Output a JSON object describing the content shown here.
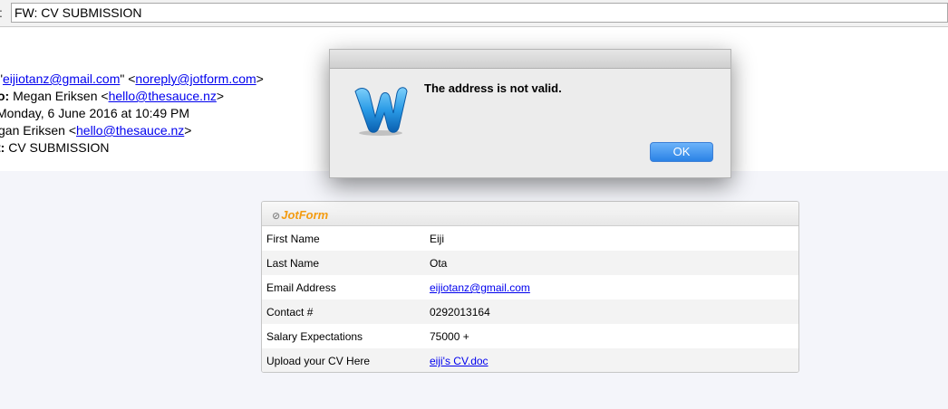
{
  "subject": {
    "prefix": ":",
    "value": "FW: CV SUBMISSION"
  },
  "headers": {
    "from_prefix": "\"",
    "from_link": "eijiotanz@gmail.com",
    "from_mid": "\" <",
    "from_link2": "noreply@jotform.com",
    "from_end": ">",
    "reply_label": "o:",
    "reply_name": " Megan Eriksen <",
    "reply_link": "hello@thesauce.nz",
    "reply_end": ">",
    "date_text": "Monday, 6 June 2016 at 10:49 PM",
    "to_name": "gan Eriksen <",
    "to_link": "hello@thesauce.nz",
    "to_end": ">",
    "subj_label": "t:",
    "subj_text": " CV SUBMISSION"
  },
  "jotform": {
    "logo_mark": "⊘",
    "logo_text": "JotForm",
    "rows": [
      {
        "label": "First Name",
        "value": "Eiji"
      },
      {
        "label": "Last Name",
        "value": "Ota"
      },
      {
        "label": "Email Address",
        "value": "eijiotanz@gmail.com"
      },
      {
        "label": "Contact #",
        "value": "0292013164"
      },
      {
        "label": "Salary Expectations",
        "value": "75000 +"
      },
      {
        "label": "Upload your CV Here",
        "value": "eiji's CV.doc"
      }
    ]
  },
  "dialog": {
    "message": "The address is not valid.",
    "ok_label": "OK",
    "icon": "word-icon",
    "accent": "#2a82e6"
  }
}
